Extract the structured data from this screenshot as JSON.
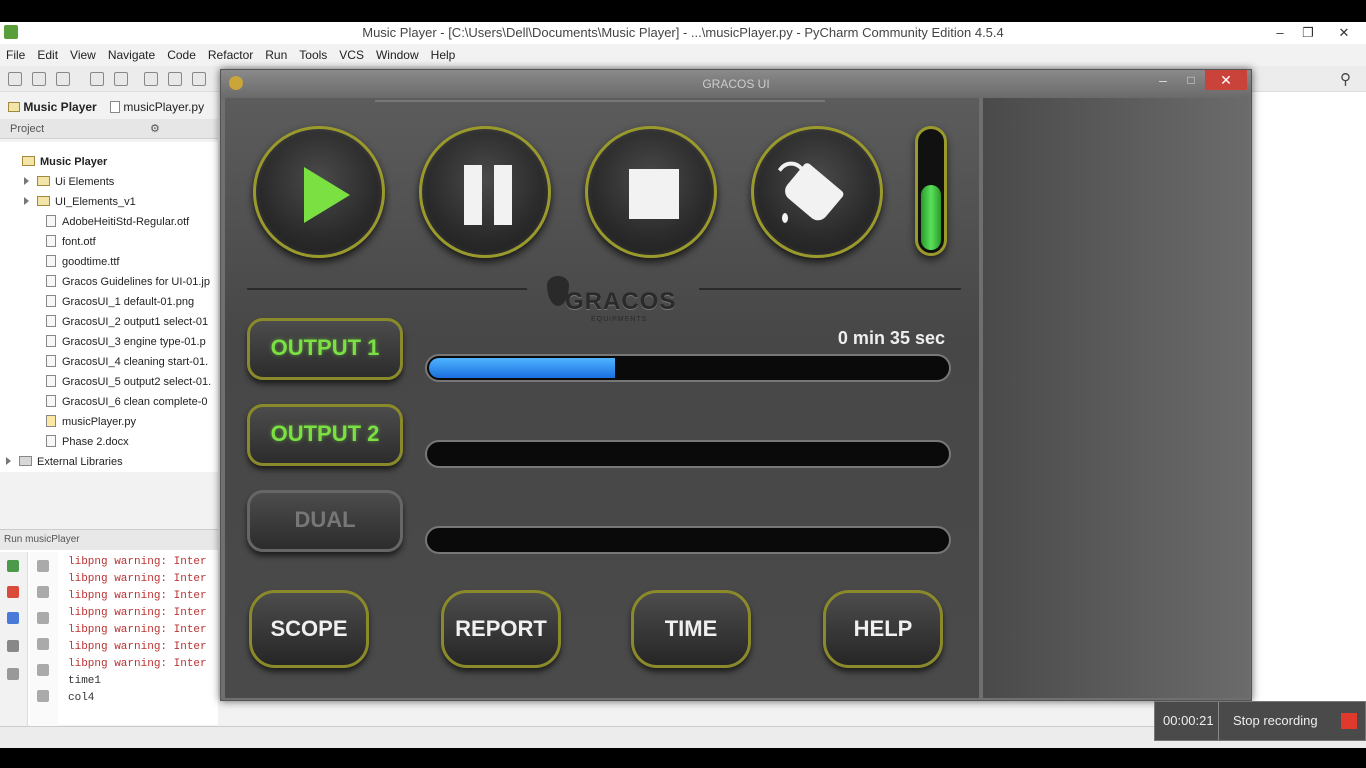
{
  "ide": {
    "title": "Music Player - [C:\\Users\\Dell\\Documents\\Music Player] - ...\\musicPlayer.py - PyCharm Community Edition 4.5.4",
    "menu": [
      "File",
      "Edit",
      "View",
      "Navigate",
      "Code",
      "Refactor",
      "Run",
      "Tools",
      "VCS",
      "Window",
      "Help"
    ],
    "breadcrumb": {
      "project": "Music Player",
      "file": "musicPlayer.py"
    },
    "project_header": "Project",
    "tree": [
      {
        "label": "Music Player",
        "type": "root"
      },
      {
        "label": "Ui Elements",
        "type": "folder"
      },
      {
        "label": "UI_Elements_v1",
        "type": "folder"
      },
      {
        "label": "AdobeHeitiStd-Regular.otf",
        "type": "file"
      },
      {
        "label": "font.otf",
        "type": "file"
      },
      {
        "label": "goodtime.ttf",
        "type": "file"
      },
      {
        "label": "Gracos Guidelines for UI-01.jp",
        "type": "file"
      },
      {
        "label": "GracosUI_1 default-01.png",
        "type": "file"
      },
      {
        "label": "GracosUI_2 output1 select-01",
        "type": "file"
      },
      {
        "label": "GracosUI_3 engine type-01.p",
        "type": "file"
      },
      {
        "label": "GracosUI_4 cleaning start-01.",
        "type": "file"
      },
      {
        "label": "GracosUI_5 output2 select-01.",
        "type": "file"
      },
      {
        "label": "GracosUI_6 clean complete-0",
        "type": "file"
      },
      {
        "label": "musicPlayer.py",
        "type": "file"
      },
      {
        "label": "Phase 2.docx",
        "type": "file"
      },
      {
        "label": "External Libraries",
        "type": "lib"
      }
    ],
    "run_header": "Run  musicPlayer",
    "run_log": [
      "libpng warning: Inter",
      "libpng warning: Inter",
      "libpng warning: Inter",
      "libpng warning: Inter",
      "libpng warning: Inter",
      "libpng warning: Inter",
      "libpng warning: Inter",
      "time1",
      "col4"
    ],
    "recorder": {
      "time": "00:00:21",
      "label": "Stop recording"
    }
  },
  "gracos": {
    "title": "GRACOS UI",
    "logo": "GRACOS",
    "logo_sub": "EQUIPMENTS",
    "timer": "0 min 35 sec",
    "level_fraction": 0.55,
    "outputs": [
      {
        "label": "OUTPUT 1",
        "state": "active",
        "progress": 0.36
      },
      {
        "label": "OUTPUT 2",
        "state": "active",
        "progress": 0
      },
      {
        "label": "DUAL",
        "state": "disabled",
        "progress": 0
      }
    ],
    "bottom_buttons": [
      "SCOPE",
      "REPORT",
      "TIME",
      "HELP"
    ],
    "colors": {
      "accent_green": "#7be042",
      "progress_blue": "#2a8cf5",
      "close_red": "#c9433a",
      "ring": "#9a9a2c"
    }
  }
}
